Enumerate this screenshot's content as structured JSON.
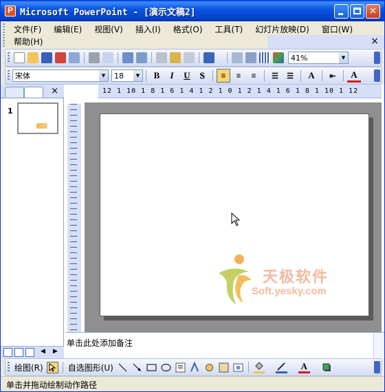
{
  "window": {
    "title": "Microsoft PowerPoint - [演示文稿2]"
  },
  "menu": {
    "items": [
      "文件(F)",
      "编辑(E)",
      "视图(V)",
      "插入(I)",
      "格式(O)",
      "工具(T)",
      "幻灯片放映(D)",
      "窗口(W)"
    ],
    "help": "帮助(H)",
    "close_symbol": "×"
  },
  "standard_toolbar": {
    "zoom": "41%"
  },
  "format_toolbar": {
    "font": "宋体",
    "size": "18",
    "bold": "B",
    "italic": "I",
    "underline": "U",
    "shadow": "S",
    "grow_font": "A",
    "font_color": "A"
  },
  "outline_pane": {
    "close_symbol": "×",
    "slide_number": "1"
  },
  "ruler": {
    "top_scale": "12 1 10 1 8 1 6 1 4 1 2 1 0 1 2 1 4 1 6 1 8 1 10 1 12"
  },
  "slide": {
    "watermark_cn": "天极软件",
    "watermark_en": "Soft.yesky.com"
  },
  "notes": {
    "placeholder": "单击此处添加备注"
  },
  "drawing_toolbar": {
    "draw_label": "绘图(R)",
    "autoshapes_label": "自选图形(U)",
    "font_color": "A"
  },
  "status": {
    "text": "单击并拖动绘制动作路径"
  },
  "colors": {
    "titlebar": "#0A55E0",
    "toolbar": "#D3DCF3",
    "canvas": "#8F8F8F",
    "active_button": "#FFD56B"
  }
}
